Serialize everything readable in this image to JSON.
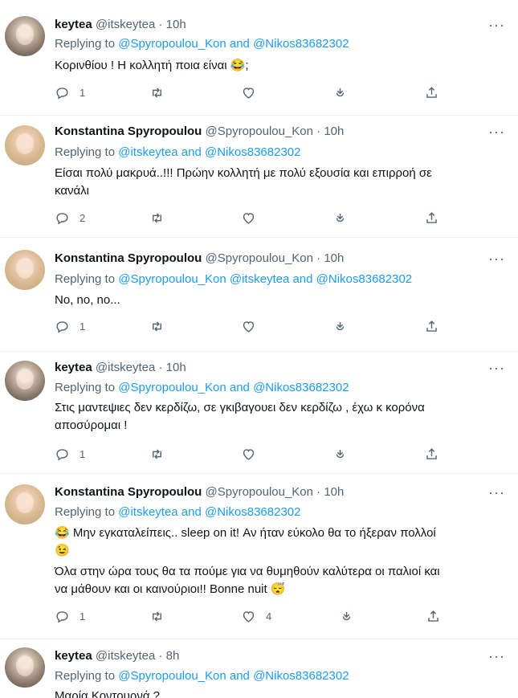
{
  "tweets": [
    {
      "name": "keytea",
      "handle": "@itskeytea",
      "time": "10h",
      "replying_prefix": "Replying to",
      "replying_links": "@Spyropoulou_Kon and @Nikos83682302",
      "text": [
        "Κορινθίου ! Η κολλητή ποια είναι 😂;"
      ],
      "reply_count": "1",
      "like_count": "",
      "avatar": "keytea"
    },
    {
      "name": "Konstantina Spyropoulou",
      "handle": "@Spyropoulou_Kon",
      "time": "10h",
      "replying_prefix": "Replying to",
      "replying_links": "@itskeytea and @Nikos83682302",
      "text": [
        "Είσαι πολύ μακρυά..!!! Πρώην κολλητή με πολύ εξουσία και επιρροή σε",
        "κανάλι"
      ],
      "reply_count": "2",
      "like_count": "",
      "avatar": "konst"
    },
    {
      "name": "Konstantina Spyropoulou",
      "handle": "@Spyropoulou_Kon",
      "time": "10h",
      "replying_prefix": "Replying to",
      "replying_links": "@Spyropoulou_Kon @itskeytea and @Nikos83682302",
      "text": [
        "No, no, no..."
      ],
      "reply_count": "1",
      "like_count": "",
      "avatar": "konst"
    },
    {
      "name": "keytea",
      "handle": "@itskeytea",
      "time": "10h",
      "replying_prefix": "Replying to",
      "replying_links": "@Spyropoulou_Kon and @Nikos83682302",
      "text": [
        "Στις μαντεψιες δεν κερδίζω, σε γκιβαγουει δεν κερδίζω , έχω κ κορόνα",
        "αποσύρομαι !"
      ],
      "reply_count": "1",
      "like_count": "",
      "avatar": "keytea"
    },
    {
      "name": "Konstantina Spyropoulou",
      "handle": "@Spyropoulou_Kon",
      "time": "10h",
      "replying_prefix": "Replying to",
      "replying_links": "@itskeytea and @Nikos83682302",
      "text": [
        "😂 Μην εγκαταλείπεις.. sleep on it! Αν ήταν εύκολο θα το ήξεραν πολλοί",
        "😉",
        "Όλα στην ώρα τους θα τα πούμε για να θυμηθούν καλύτερα οι παλιοί και",
        "να μάθουν και οι καινούριοι!! Bonne nuit 😴"
      ],
      "reply_count": "1",
      "like_count": "4",
      "avatar": "konst"
    },
    {
      "name": "keytea",
      "handle": "@itskeytea",
      "time": "8h",
      "replying_prefix": "Replying to",
      "replying_links": "@Spyropoulou_Kon and @Nikos83682302",
      "text": [
        "Μαρία Κοντουρνά ?"
      ],
      "reply_count": "",
      "like_count": "",
      "avatar": "keytea"
    }
  ],
  "separator": "·",
  "colors": {
    "link": "#1d9bf0",
    "muted": "#536471",
    "text": "#0f1419"
  }
}
